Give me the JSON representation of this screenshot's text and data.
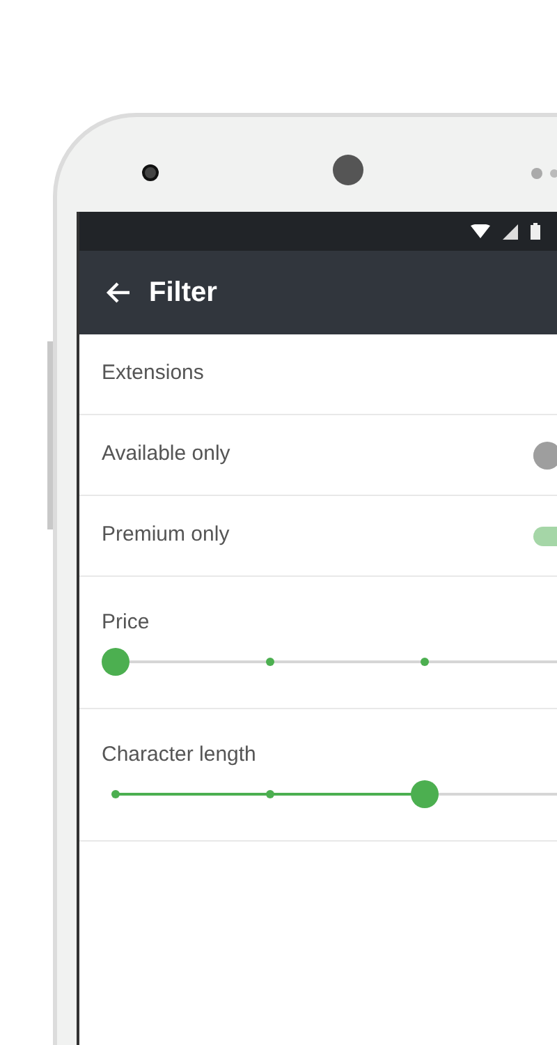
{
  "app_bar": {
    "title": "Filter"
  },
  "filters": [
    {
      "kind": "header",
      "label": "Extensions"
    },
    {
      "kind": "switch",
      "label": "Available only",
      "on": false
    },
    {
      "kind": "switch",
      "label": "Premium only",
      "on": true
    },
    {
      "kind": "slider",
      "label": "Price",
      "level": 0
    },
    {
      "kind": "slider",
      "label": "Character length",
      "level": 0.667
    }
  ]
}
